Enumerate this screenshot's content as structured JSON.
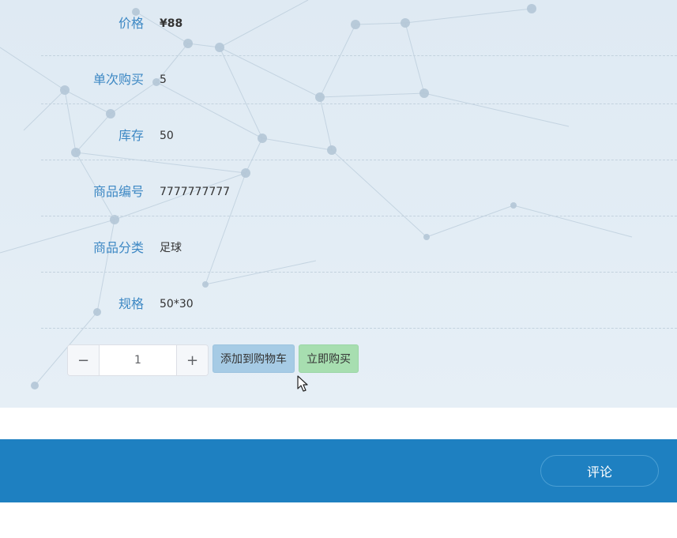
{
  "product_info": [
    {
      "label": "价格",
      "value": "¥88"
    },
    {
      "label": "单次购买",
      "value": "5"
    },
    {
      "label": "库存",
      "value": "50"
    },
    {
      "label": "商品编号",
      "value": "7777777777"
    },
    {
      "label": "商品分类",
      "value": "足球"
    },
    {
      "label": "规格",
      "value": "50*30"
    }
  ],
  "quantity": {
    "value": "1",
    "minus": "−",
    "plus": "+"
  },
  "actions": {
    "add_to_cart": "添加到购物车",
    "buy_now": "立即购买"
  },
  "footer": {
    "comment": "评论"
  },
  "colors": {
    "label": "#3d88c4",
    "footer": "#1e80c1",
    "add_cart": "#a6cbe5",
    "buy_now": "#a7deb0"
  }
}
